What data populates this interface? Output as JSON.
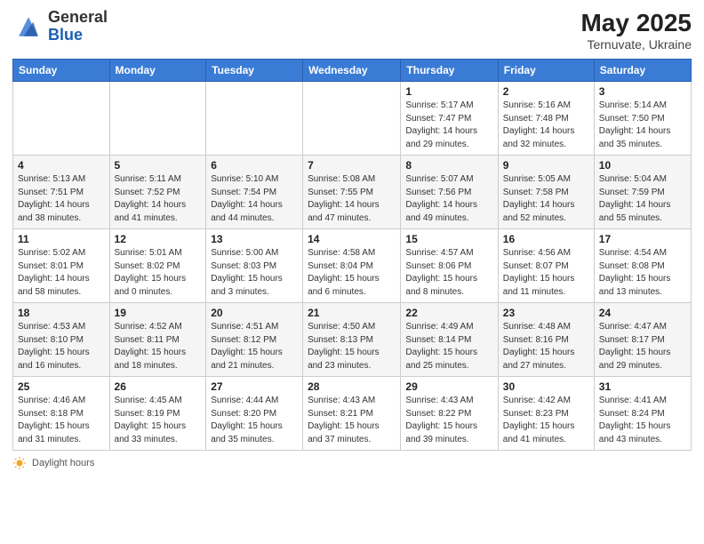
{
  "header": {
    "logo_general": "General",
    "logo_blue": "Blue",
    "month_year": "May 2025",
    "location": "Ternuvate, Ukraine"
  },
  "columns": [
    "Sunday",
    "Monday",
    "Tuesday",
    "Wednesday",
    "Thursday",
    "Friday",
    "Saturday"
  ],
  "weeks": [
    [
      {
        "day": "",
        "info": ""
      },
      {
        "day": "",
        "info": ""
      },
      {
        "day": "",
        "info": ""
      },
      {
        "day": "",
        "info": ""
      },
      {
        "day": "1",
        "info": "Sunrise: 5:17 AM\nSunset: 7:47 PM\nDaylight: 14 hours\nand 29 minutes."
      },
      {
        "day": "2",
        "info": "Sunrise: 5:16 AM\nSunset: 7:48 PM\nDaylight: 14 hours\nand 32 minutes."
      },
      {
        "day": "3",
        "info": "Sunrise: 5:14 AM\nSunset: 7:50 PM\nDaylight: 14 hours\nand 35 minutes."
      }
    ],
    [
      {
        "day": "4",
        "info": "Sunrise: 5:13 AM\nSunset: 7:51 PM\nDaylight: 14 hours\nand 38 minutes."
      },
      {
        "day": "5",
        "info": "Sunrise: 5:11 AM\nSunset: 7:52 PM\nDaylight: 14 hours\nand 41 minutes."
      },
      {
        "day": "6",
        "info": "Sunrise: 5:10 AM\nSunset: 7:54 PM\nDaylight: 14 hours\nand 44 minutes."
      },
      {
        "day": "7",
        "info": "Sunrise: 5:08 AM\nSunset: 7:55 PM\nDaylight: 14 hours\nand 47 minutes."
      },
      {
        "day": "8",
        "info": "Sunrise: 5:07 AM\nSunset: 7:56 PM\nDaylight: 14 hours\nand 49 minutes."
      },
      {
        "day": "9",
        "info": "Sunrise: 5:05 AM\nSunset: 7:58 PM\nDaylight: 14 hours\nand 52 minutes."
      },
      {
        "day": "10",
        "info": "Sunrise: 5:04 AM\nSunset: 7:59 PM\nDaylight: 14 hours\nand 55 minutes."
      }
    ],
    [
      {
        "day": "11",
        "info": "Sunrise: 5:02 AM\nSunset: 8:01 PM\nDaylight: 14 hours\nand 58 minutes."
      },
      {
        "day": "12",
        "info": "Sunrise: 5:01 AM\nSunset: 8:02 PM\nDaylight: 15 hours\nand 0 minutes."
      },
      {
        "day": "13",
        "info": "Sunrise: 5:00 AM\nSunset: 8:03 PM\nDaylight: 15 hours\nand 3 minutes."
      },
      {
        "day": "14",
        "info": "Sunrise: 4:58 AM\nSunset: 8:04 PM\nDaylight: 15 hours\nand 6 minutes."
      },
      {
        "day": "15",
        "info": "Sunrise: 4:57 AM\nSunset: 8:06 PM\nDaylight: 15 hours\nand 8 minutes."
      },
      {
        "day": "16",
        "info": "Sunrise: 4:56 AM\nSunset: 8:07 PM\nDaylight: 15 hours\nand 11 minutes."
      },
      {
        "day": "17",
        "info": "Sunrise: 4:54 AM\nSunset: 8:08 PM\nDaylight: 15 hours\nand 13 minutes."
      }
    ],
    [
      {
        "day": "18",
        "info": "Sunrise: 4:53 AM\nSunset: 8:10 PM\nDaylight: 15 hours\nand 16 minutes."
      },
      {
        "day": "19",
        "info": "Sunrise: 4:52 AM\nSunset: 8:11 PM\nDaylight: 15 hours\nand 18 minutes."
      },
      {
        "day": "20",
        "info": "Sunrise: 4:51 AM\nSunset: 8:12 PM\nDaylight: 15 hours\nand 21 minutes."
      },
      {
        "day": "21",
        "info": "Sunrise: 4:50 AM\nSunset: 8:13 PM\nDaylight: 15 hours\nand 23 minutes."
      },
      {
        "day": "22",
        "info": "Sunrise: 4:49 AM\nSunset: 8:14 PM\nDaylight: 15 hours\nand 25 minutes."
      },
      {
        "day": "23",
        "info": "Sunrise: 4:48 AM\nSunset: 8:16 PM\nDaylight: 15 hours\nand 27 minutes."
      },
      {
        "day": "24",
        "info": "Sunrise: 4:47 AM\nSunset: 8:17 PM\nDaylight: 15 hours\nand 29 minutes."
      }
    ],
    [
      {
        "day": "25",
        "info": "Sunrise: 4:46 AM\nSunset: 8:18 PM\nDaylight: 15 hours\nand 31 minutes."
      },
      {
        "day": "26",
        "info": "Sunrise: 4:45 AM\nSunset: 8:19 PM\nDaylight: 15 hours\nand 33 minutes."
      },
      {
        "day": "27",
        "info": "Sunrise: 4:44 AM\nSunset: 8:20 PM\nDaylight: 15 hours\nand 35 minutes."
      },
      {
        "day": "28",
        "info": "Sunrise: 4:43 AM\nSunset: 8:21 PM\nDaylight: 15 hours\nand 37 minutes."
      },
      {
        "day": "29",
        "info": "Sunrise: 4:43 AM\nSunset: 8:22 PM\nDaylight: 15 hours\nand 39 minutes."
      },
      {
        "day": "30",
        "info": "Sunrise: 4:42 AM\nSunset: 8:23 PM\nDaylight: 15 hours\nand 41 minutes."
      },
      {
        "day": "31",
        "info": "Sunrise: 4:41 AM\nSunset: 8:24 PM\nDaylight: 15 hours\nand 43 minutes."
      }
    ]
  ],
  "footer": {
    "daylight_hours_label": "Daylight hours"
  }
}
